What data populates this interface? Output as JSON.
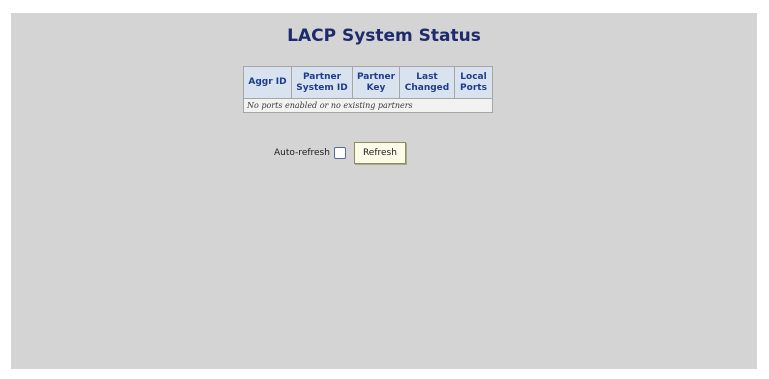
{
  "page": {
    "title": "LACP System Status"
  },
  "table": {
    "headers": [
      "Aggr ID",
      "Partner\nSystem ID",
      "Partner\nKey",
      "Last\nChanged",
      "Local\nPorts"
    ],
    "empty_message": "No ports enabled or no existing partners"
  },
  "controls": {
    "auto_refresh_label": "Auto-refresh",
    "auto_refresh_checked": false,
    "refresh_label": "Refresh"
  },
  "colors": {
    "panel_bg": "#d4d4d4",
    "title": "#1d2b6e",
    "header_text": "#1d3d8c",
    "header_bg": "#d9e3f0"
  }
}
